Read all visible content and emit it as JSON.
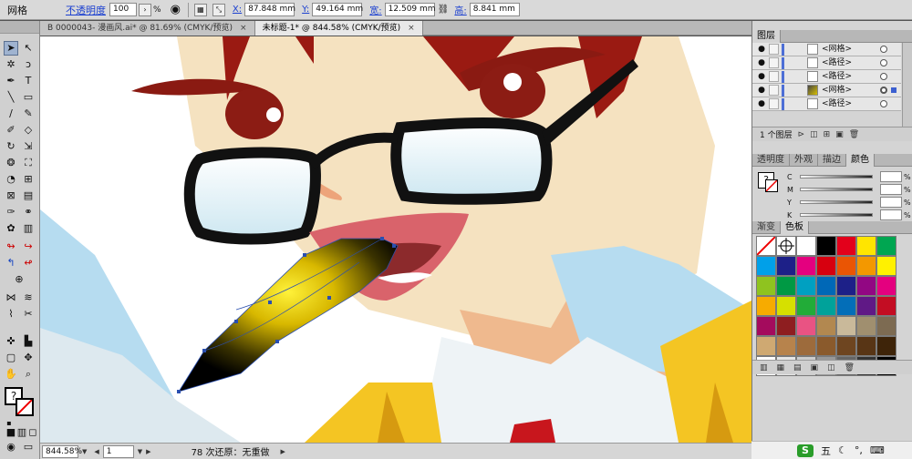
{
  "control_bar": {
    "selection_type": "网格",
    "opacity_label": "不透明度",
    "opacity_value": "100",
    "opacity_unit": "%",
    "x_label": "X:",
    "x_value": "87.848 mm",
    "y_label": "Y:",
    "y_value": "49.164 mm",
    "w_label": "宽:",
    "w_value": "12.509 mm",
    "h_label": "高:",
    "h_value": "8.841 mm"
  },
  "tabs": [
    {
      "label": "B 0000043- 漫画风.ai* @ 81.69% (CMYK/预览)",
      "close": "×",
      "active": false
    },
    {
      "label": "未标题-1* @ 844.58% (CMYK/预览)",
      "close": "×",
      "active": true
    }
  ],
  "status_bar": {
    "zoom": "844.58%",
    "artboard": "1",
    "undo_info": "78 次还原：无重做"
  },
  "layers_panel": {
    "tab": "图层",
    "rows": [
      {
        "name": "<网格>",
        "selected": false
      },
      {
        "name": "<路径>",
        "selected": false
      },
      {
        "name": "<路径>",
        "selected": false
      },
      {
        "name": "<网格>",
        "selected": true
      },
      {
        "name": "<路径>",
        "selected": false
      }
    ],
    "footer": "1 个图层"
  },
  "color_panel": {
    "tabs": [
      "透明度",
      "外观",
      "描边",
      "颜色"
    ],
    "active_tab": "颜色",
    "channels": [
      {
        "label": "C",
        "unit": "%"
      },
      {
        "label": "M",
        "unit": "%"
      },
      {
        "label": "Y",
        "unit": "%"
      },
      {
        "label": "K",
        "unit": "%"
      }
    ]
  },
  "swatch_panel": {
    "tabs": [
      "渐变",
      "色板"
    ],
    "active_tab": "色板",
    "swatches": [
      "#ffffff",
      "#ffffff",
      "#ffffff",
      "#000000",
      "#e3001b",
      "#ffe500",
      "#00a651",
      "#00a0e9",
      "#1d2088",
      "#e4007f",
      "#d7000f",
      "#ea5504",
      "#f39800",
      "#fff100",
      "#8fc31f",
      "#009944",
      "#00a0c1",
      "#0068b7",
      "#1d2088",
      "#920783",
      "#e4007f",
      "#f7ab00",
      "#d6e000",
      "#22ac38",
      "#00a29a",
      "#036eb8",
      "#601986",
      "#c30d23",
      "#a40b5d",
      "#8e1e20",
      "#e95383",
      "#b28850",
      "#c9b99a",
      "#a08f6f",
      "#7d6b52",
      "#cfa972",
      "#b7834c",
      "#9d6b3c",
      "#8a5a2c",
      "#6e4520",
      "#583515",
      "#3e2409",
      "#ffffff",
      "#e6e6e6",
      "#cccccc",
      "#999999",
      "#666666",
      "#333333",
      "#000000"
    ]
  },
  "tray": {
    "ime_label": "S",
    "ime_mode": "五"
  }
}
